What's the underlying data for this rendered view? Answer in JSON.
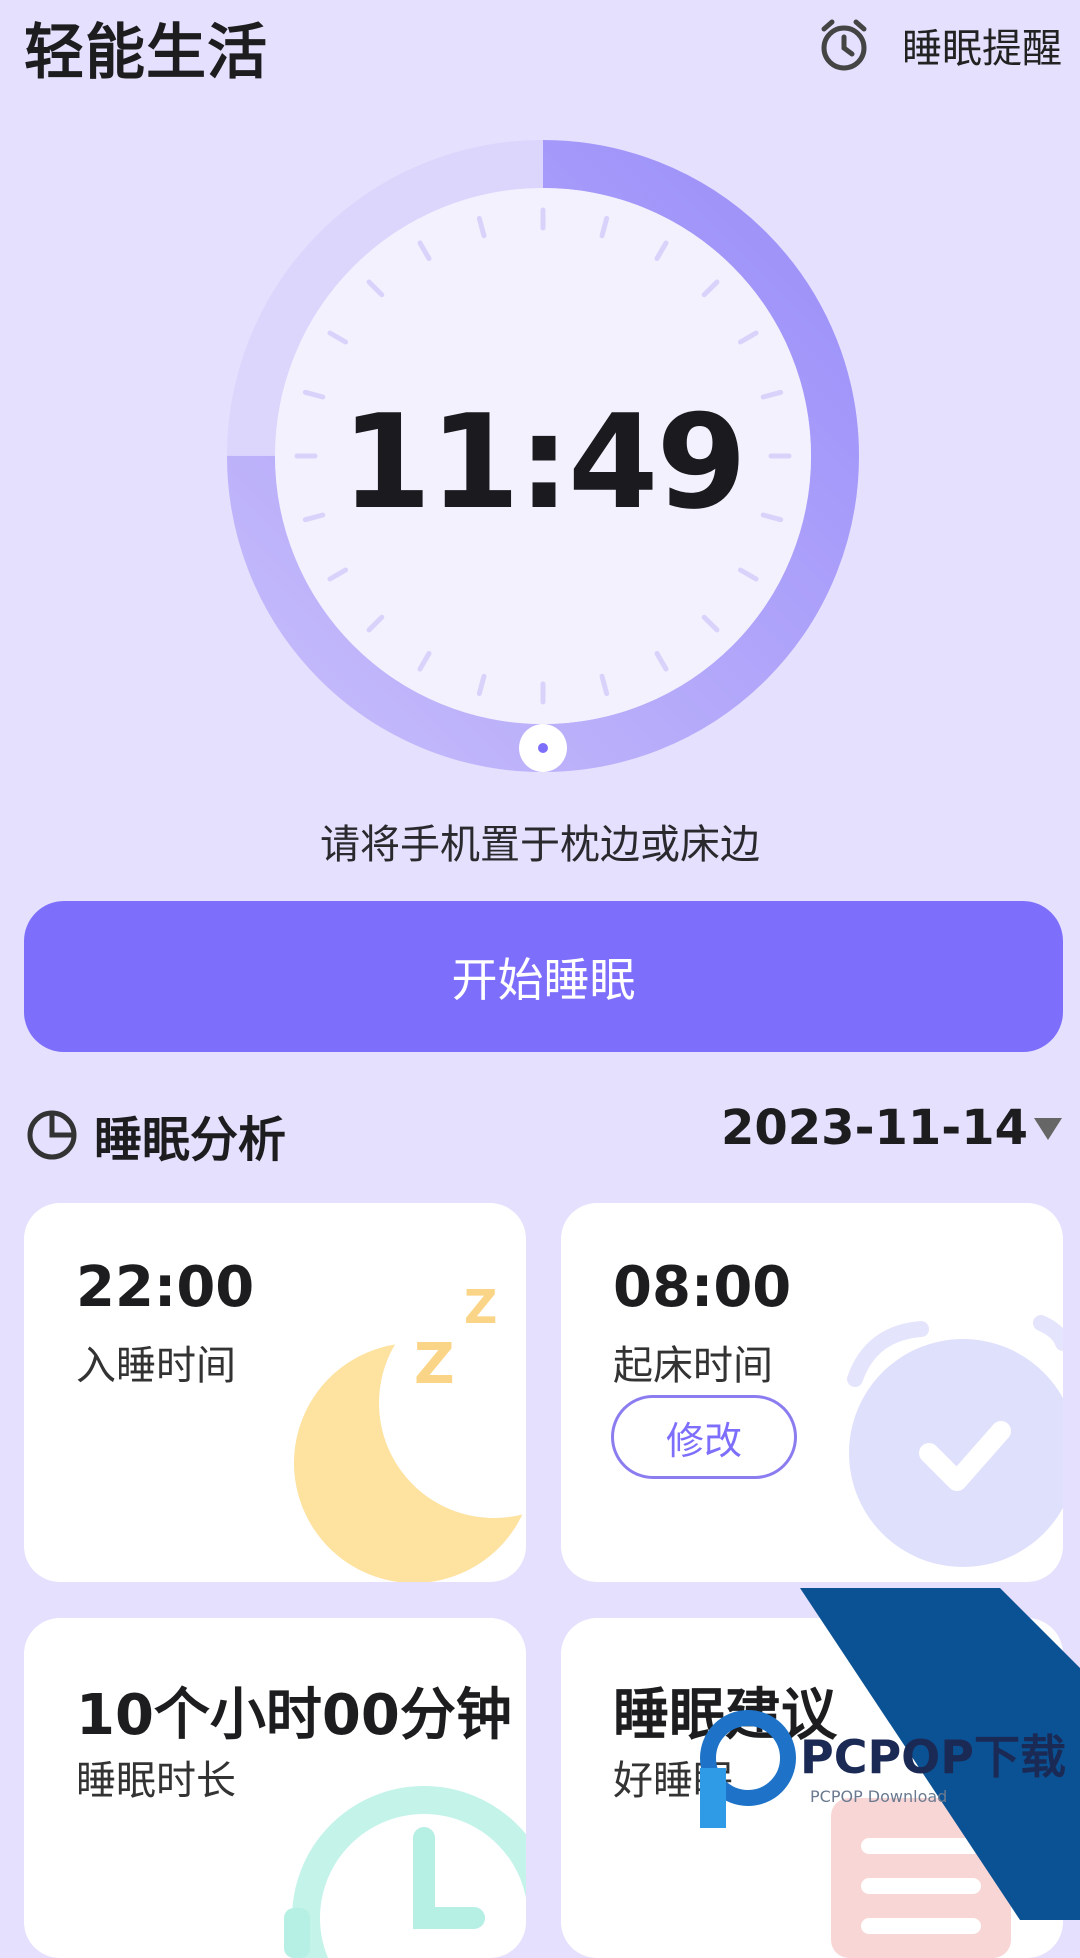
{
  "header": {
    "app_title": "轻能生活",
    "reminder_label": "睡眠提醒",
    "reminder_icon": "alarm-clock-icon"
  },
  "clock": {
    "time": "11:49"
  },
  "hint": "请将手机置于枕边或床边",
  "start_button": {
    "label": "开始睡眠"
  },
  "analysis": {
    "title": "睡眠分析",
    "icon": "pie-chart-icon",
    "date": "2023-11-14"
  },
  "cards": {
    "bedtime": {
      "value": "22:00",
      "label": "入睡时间"
    },
    "wake": {
      "value": "08:00",
      "label": "起床时间",
      "edit_label": "修改"
    },
    "duration": {
      "value": "10个小时00分钟",
      "label": "睡眠时长"
    },
    "advice": {
      "title": "睡眠建议",
      "subtitle": "好睡眠"
    }
  },
  "watermark": {
    "brand": "PCPOP下载",
    "sub": "PCPOP Download"
  },
  "colors": {
    "background": "#e5e0fe",
    "accent": "#7d6ffb",
    "card": "#ffffff"
  }
}
